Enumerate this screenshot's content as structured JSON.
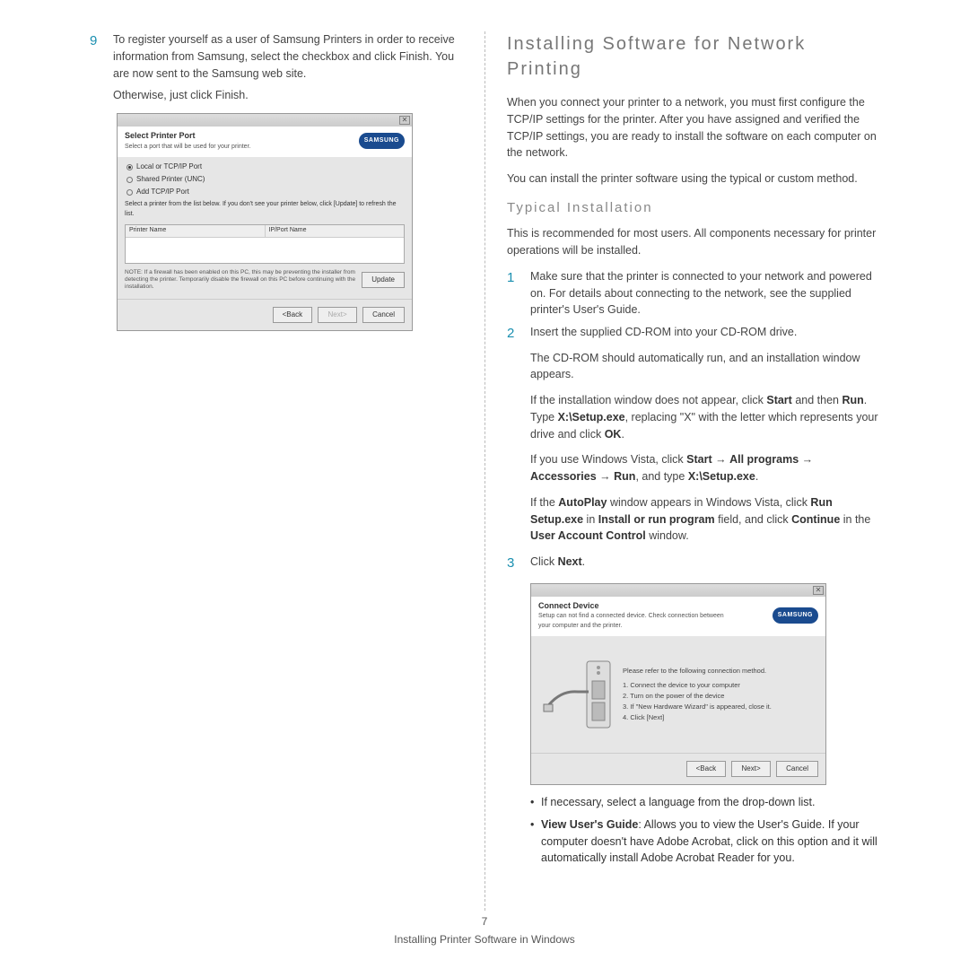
{
  "left": {
    "step9_num": "9",
    "step9_text": "To register yourself as a user of Samsung Printers in order to receive information from Samsung, select the checkbox and click Finish. You are now sent to the Samsung web site.",
    "otherwise": "Otherwise, just click Finish.",
    "dialog": {
      "title": "Select Printer Port",
      "subtitle": "Select a port that will be used for your printer.",
      "brand": "SAMSUNG",
      "radio1": "Local or TCP/IP Port",
      "radio2": "Shared Printer (UNC)",
      "radio3": "Add TCP/IP Port",
      "listnote": "Select a printer from the list below. If you don't see your printer below, click [Update] to refresh the list.",
      "col1": "Printer Name",
      "col2": "IP/Port Name",
      "warn": "NOTE: If a firewall has been enabled on this PC, this may be preventing the installer from detecting the printer. Temporarily disable the firewall on this PC before continuing with the installation.",
      "update": "Update",
      "back": "<Back",
      "next": "Next>",
      "cancel": "Cancel"
    }
  },
  "right": {
    "h2": "Installing Software for Network Printing",
    "p1": "When you connect your printer to a network, you must first configure the TCP/IP settings for the printer. After you have assigned and verified the TCP/IP settings, you are ready to install the software on each computer on the network.",
    "p2": "You can install the printer software using the typical or custom method.",
    "h3": "Typical Installation",
    "p3": "This is recommended for most users. All components necessary for printer operations will be installed.",
    "step1_num": "1",
    "step1_text": "Make sure that the printer is connected to your network and powered on. For details about connecting to the network, see the supplied printer's User's Guide.",
    "step2_num": "2",
    "step2_text": "Insert the supplied CD-ROM into your CD-ROM drive.",
    "step2a": "The CD-ROM should automatically run, and an installation window appears.",
    "step2b_1": "If the installation window does not appear, click ",
    "step2b_start": "Start",
    "step2b_2": " and then ",
    "step2b_run": "Run",
    "step2b_3": ". Type ",
    "step2b_path": "X:\\Setup.exe",
    "step2b_4": ", replacing \"X\" with the letter which represents your drive and click ",
    "step2b_ok": "OK",
    "step2b_5": ".",
    "step2c_1": "If you use Windows Vista, click ",
    "step2c_start": "Start",
    "step2c_arrow": " → ",
    "step2c_all": "All programs",
    "step2c_acc": "Accessories",
    "step2c_run": "Run",
    "step2c_2": ", and type ",
    "step2c_path": "X:\\Setup.exe",
    "step2c_3": ".",
    "step2d_1": "If the ",
    "step2d_auto": "AutoPlay",
    "step2d_2": " window appears in Windows Vista, click ",
    "step2d_run": "Run Setup.exe",
    "step2d_3": " in ",
    "step2d_install": "Install or run program",
    "step2d_4": " field, and click ",
    "step2d_cont": "Continue",
    "step2d_5": " in the ",
    "step2d_uac": "User Account Control",
    "step2d_6": " window.",
    "step3_num": "3",
    "step3_text_1": "Click ",
    "step3_next": "Next",
    "step3_text_2": ".",
    "dialog2": {
      "title": "Connect Device",
      "subtitle": "Setup can not find a connected device. Check connection between your computer and the printer.",
      "brand": "SAMSUNG",
      "lead": "Please refer to the following connection method.",
      "l1": "1. Connect the device to your computer",
      "l2": "2. Turn on the power of the device",
      "l3": "3. If \"New Hardware Wizard\" is appeared, close it.",
      "l4": "4. Click [Next]",
      "back": "<Back",
      "next": "Next>",
      "cancel": "Cancel"
    },
    "bullet1": "If necessary, select a language from the drop-down list.",
    "bullet2_lead": "View User's Guide",
    "bullet2_rest": ": Allows you to view the User's Guide. If your computer doesn't have Adobe Acrobat, click on this option and it will automatically install Adobe Acrobat Reader for you."
  },
  "footer": {
    "page": "7",
    "caption": "Installing Printer Software in Windows"
  }
}
